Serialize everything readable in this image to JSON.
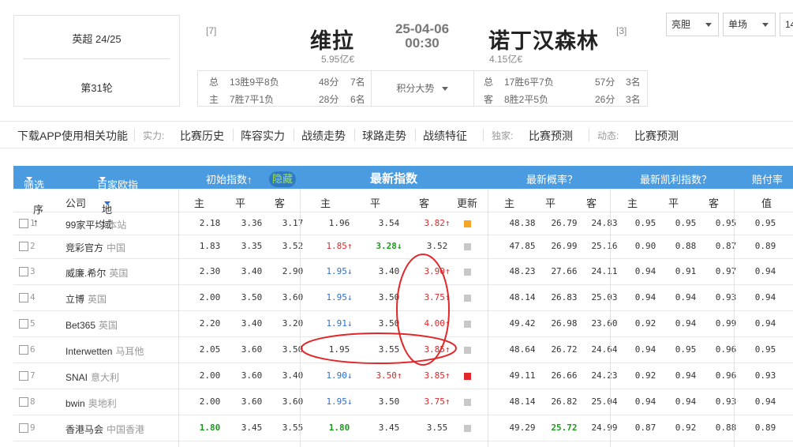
{
  "league": {
    "name": "英超 24/25",
    "round": "第31轮"
  },
  "match": {
    "home": {
      "rank": "[7]",
      "name": "维拉",
      "value": "5.95亿€"
    },
    "away": {
      "rank": "[3]",
      "name": "诺丁汉森林",
      "value": "4.15亿€"
    },
    "date": "25-04-06",
    "time": "00:30",
    "trend_label": "积分大势",
    "home_stats": [
      {
        "tag": "总",
        "record": "13胜9平8负",
        "points": "48分",
        "rank": "7名"
      },
      {
        "tag": "主",
        "record": "7胜7平1负",
        "points": "28分",
        "rank": "6名"
      }
    ],
    "away_stats": [
      {
        "tag": "总",
        "record": "17胜6平7负",
        "points": "57分",
        "rank": "3名"
      },
      {
        "tag": "客",
        "record": "8胜2平5负",
        "points": "26分",
        "rank": "3名"
      }
    ]
  },
  "selectors": [
    "亮胆",
    "单场",
    "14"
  ],
  "nav": {
    "app": "下载APP使用相关功能",
    "strength_label": "实力:",
    "strength_items": [
      "比赛历史",
      "阵容实力",
      "战绩走势",
      "球路走势",
      "战绩特征"
    ],
    "exclusive_label": "独家:",
    "exclusive_item": "比赛预测",
    "dynamic_label": "动态:",
    "dynamic_item": "比赛预测"
  },
  "table": {
    "head": {
      "filter": "筛选",
      "baijia": "百家欧指",
      "initial": "初始指数↑",
      "hide": "隐藏",
      "latest": "最新指数",
      "prob": "最新概率？",
      "kelly": "最新凯利指数？",
      "payout": "赔付率"
    },
    "sub": {
      "seq": "序↑",
      "company": "公司",
      "region": "地域",
      "home": "主",
      "draw": "平",
      "away": "客",
      "update": "更新",
      "value": "值"
    },
    "rows": [
      {
        "no": "1",
        "company": "99家平均",
        "region": "本站",
        "init": [
          "2.18",
          "3.36",
          "3.17"
        ],
        "latest": [
          {
            "v": "1.96",
            "c": ""
          },
          {
            "v": "3.54",
            "c": ""
          },
          {
            "v": "3.82↑",
            "c": "red"
          }
        ],
        "upd": "#f5a623",
        "prob": [
          "48.38",
          "26.79",
          "24.83"
        ],
        "probc": [
          "",
          "",
          ""
        ],
        "kelly": [
          "0.95",
          "0.95",
          "0.95"
        ],
        "pay": "0.95",
        "initc": [
          "",
          "",
          ""
        ]
      },
      {
        "no": "2",
        "company": "竞彩官方",
        "region": "中国",
        "init": [
          "1.83",
          "3.35",
          "3.52"
        ],
        "latest": [
          {
            "v": "1.85↑",
            "c": "red"
          },
          {
            "v": "3.28↓",
            "c": "green"
          },
          {
            "v": "3.52",
            "c": ""
          }
        ],
        "upd": "#c8c8c8",
        "prob": [
          "47.85",
          "26.99",
          "25.16"
        ],
        "probc": [
          "",
          "",
          ""
        ],
        "kelly": [
          "0.90",
          "0.88",
          "0.87"
        ],
        "pay": "0.89",
        "initc": [
          "",
          "",
          ""
        ]
      },
      {
        "no": "3",
        "company": "威廉.希尔",
        "region": "英国",
        "init": [
          "2.30",
          "3.40",
          "2.90"
        ],
        "latest": [
          {
            "v": "1.95↓",
            "c": "blue"
          },
          {
            "v": "3.40",
            "c": ""
          },
          {
            "v": "3.90↑",
            "c": "red"
          }
        ],
        "upd": "#c8c8c8",
        "prob": [
          "48.23",
          "27.66",
          "24.11"
        ],
        "probc": [
          "",
          "",
          ""
        ],
        "kelly": [
          "0.94",
          "0.91",
          "0.97"
        ],
        "pay": "0.94",
        "initc": [
          "",
          "",
          ""
        ]
      },
      {
        "no": "4",
        "company": "立博",
        "region": "英国",
        "init": [
          "2.00",
          "3.50",
          "3.60"
        ],
        "latest": [
          {
            "v": "1.95↓",
            "c": "blue"
          },
          {
            "v": "3.50",
            "c": ""
          },
          {
            "v": "3.75↑",
            "c": "red"
          }
        ],
        "upd": "#c8c8c8",
        "prob": [
          "48.14",
          "26.83",
          "25.03"
        ],
        "probc": [
          "",
          "",
          ""
        ],
        "kelly": [
          "0.94",
          "0.94",
          "0.93"
        ],
        "pay": "0.94",
        "initc": [
          "",
          "",
          ""
        ]
      },
      {
        "no": "5",
        "company": "Bet365",
        "region": "英国",
        "init": [
          "2.20",
          "3.40",
          "3.20"
        ],
        "latest": [
          {
            "v": "1.91↓",
            "c": "blue"
          },
          {
            "v": "3.50",
            "c": ""
          },
          {
            "v": "4.00↑",
            "c": "red"
          }
        ],
        "upd": "#c8c8c8",
        "prob": [
          "49.42",
          "26.98",
          "23.60"
        ],
        "probc": [
          "",
          "",
          ""
        ],
        "kelly": [
          "0.92",
          "0.94",
          "0.99"
        ],
        "pay": "0.94",
        "initc": [
          "",
          "",
          ""
        ]
      },
      {
        "no": "6",
        "company": "Interwetten",
        "region": "马耳他",
        "init": [
          "2.05",
          "3.60",
          "3.50"
        ],
        "latest": [
          {
            "v": "1.95",
            "c": ""
          },
          {
            "v": "3.55",
            "c": ""
          },
          {
            "v": "3.85↑",
            "c": "red"
          }
        ],
        "upd": "#c8c8c8",
        "prob": [
          "48.64",
          "26.72",
          "24.64"
        ],
        "probc": [
          "",
          "",
          ""
        ],
        "kelly": [
          "0.94",
          "0.95",
          "0.96"
        ],
        "pay": "0.95",
        "initc": [
          "",
          "",
          ""
        ]
      },
      {
        "no": "7",
        "company": "SNAI",
        "region": "意大利",
        "init": [
          "2.00",
          "3.60",
          "3.40"
        ],
        "latest": [
          {
            "v": "1.90↓",
            "c": "blue"
          },
          {
            "v": "3.50↑",
            "c": "red"
          },
          {
            "v": "3.85↑",
            "c": "red"
          }
        ],
        "upd": "#e0282a",
        "prob": [
          "49.11",
          "26.66",
          "24.23"
        ],
        "probc": [
          "",
          "",
          ""
        ],
        "kelly": [
          "0.92",
          "0.94",
          "0.96"
        ],
        "pay": "0.93",
        "initc": [
          "",
          "",
          ""
        ]
      },
      {
        "no": "8",
        "company": "bwin",
        "region": "奥地利",
        "init": [
          "2.00",
          "3.60",
          "3.60"
        ],
        "latest": [
          {
            "v": "1.95↓",
            "c": "blue"
          },
          {
            "v": "3.50",
            "c": ""
          },
          {
            "v": "3.75↑",
            "c": "red"
          }
        ],
        "upd": "#c8c8c8",
        "prob": [
          "48.14",
          "26.82",
          "25.04"
        ],
        "probc": [
          "",
          "",
          ""
        ],
        "kelly": [
          "0.94",
          "0.94",
          "0.93"
        ],
        "pay": "0.94",
        "initc": [
          "",
          "",
          ""
        ]
      },
      {
        "no": "9",
        "company": "香港马会",
        "region": "中国香港",
        "init": [
          "1.80",
          "3.45",
          "3.55"
        ],
        "latest": [
          {
            "v": "1.80",
            "c": "green"
          },
          {
            "v": "3.45",
            "c": ""
          },
          {
            "v": "3.55",
            "c": ""
          }
        ],
        "upd": "#c8c8c8",
        "prob": [
          "49.29",
          "25.72",
          "24.99"
        ],
        "probc": [
          "",
          "green",
          ""
        ],
        "kelly": [
          "0.87",
          "0.92",
          "0.88"
        ],
        "pay": "0.89",
        "initc": [
          "green",
          "",
          ""
        ]
      }
    ]
  },
  "colors": {
    "header_blue": "#4b9be0",
    "annotation": "#e0282a",
    "up": "#e0282a",
    "down": "#2a6fd6",
    "green": "#1f9a1f"
  }
}
